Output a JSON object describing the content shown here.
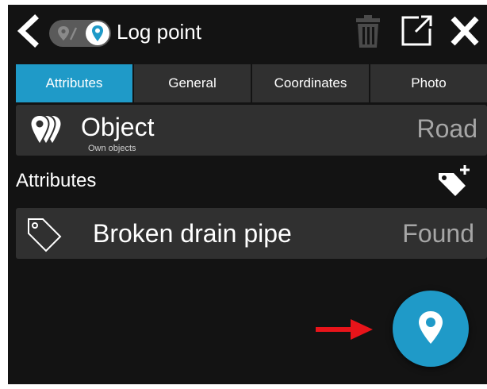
{
  "header": {
    "title": "Log point",
    "icons": [
      "back-chevron-icon",
      "map-pin-icon",
      "trash-icon",
      "expand-icon",
      "close-icon"
    ]
  },
  "tabs": [
    {
      "label": "Attributes",
      "active": true
    },
    {
      "label": "General",
      "active": false
    },
    {
      "label": "Coordinates",
      "active": false
    },
    {
      "label": "Photo",
      "active": false
    }
  ],
  "object": {
    "label": "Object",
    "sublabel": "Own objects",
    "value": "Road",
    "icon": "stacked-pins-icon"
  },
  "attributes_section": {
    "title": "Attributes",
    "add_icon": "add-tag-icon"
  },
  "attribute_rows": [
    {
      "name": "Broken drain pipe",
      "value": "Found",
      "icon": "tag-icon"
    }
  ],
  "fab": {
    "icon": "map-pin-icon"
  },
  "colors": {
    "accent": "#1f9ac8",
    "background": "#131313",
    "row": "#303030",
    "muted_text": "#a6a6a6",
    "annotation_arrow": "#e8141a"
  }
}
